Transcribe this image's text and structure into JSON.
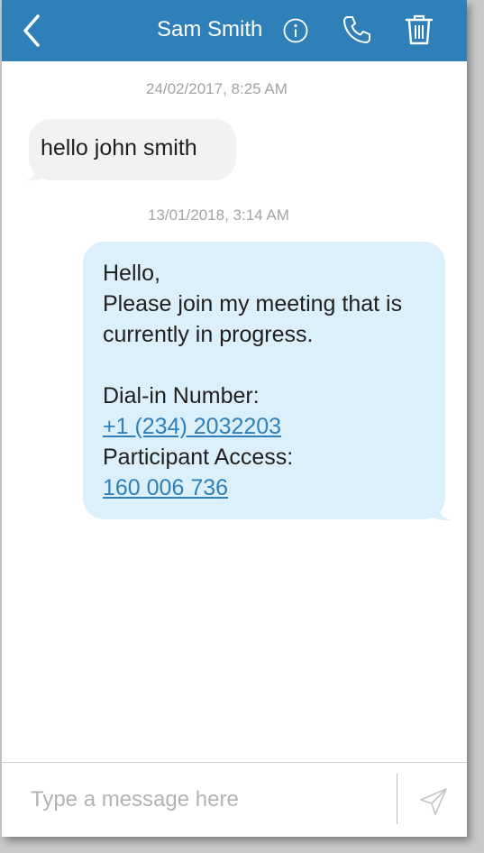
{
  "header": {
    "title": "Sam Smith",
    "back_icon": "chevron-left-icon",
    "info_icon": "info-icon",
    "call_icon": "phone-icon",
    "delete_icon": "trash-icon",
    "bar_color": "#2f7fb8"
  },
  "conversation": {
    "messages": [
      {
        "timestamp": "24/02/2017, 8:25 AM",
        "direction": "incoming",
        "text": "hello john smith"
      },
      {
        "timestamp": "13/01/2018, 3:14 AM",
        "direction": "outgoing",
        "lines": [
          "Hello,",
          "Please join my meeting that is",
          "currently in progress.",
          "Dial-in Number:",
          "Participant Access:"
        ],
        "dial_in_number": "+1 (234) 2032203",
        "access_code": "160 006 736"
      }
    ],
    "incoming_bubble_color": "#f2f2f2",
    "outgoing_bubble_color": "#dcf0fb",
    "link_color": "#2f7fb8"
  },
  "composer": {
    "placeholder": "Type a message here",
    "value": "",
    "send_icon": "send-icon"
  }
}
